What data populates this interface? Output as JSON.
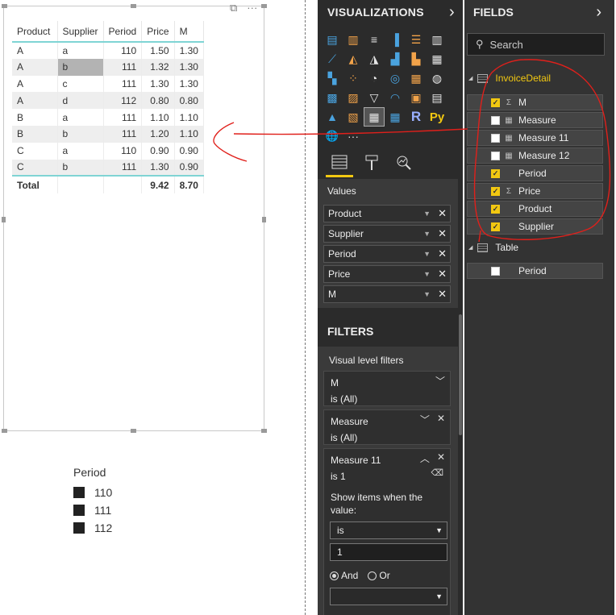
{
  "table": {
    "columns": [
      "Product",
      "Supplier",
      "Period",
      "Price",
      "M"
    ],
    "rows": [
      [
        "A",
        "a",
        "110",
        "1.50",
        "1.30"
      ],
      [
        "A",
        "b",
        "111",
        "1.32",
        "1.30"
      ],
      [
        "A",
        "c",
        "111",
        "1.30",
        "1.30"
      ],
      [
        "A",
        "d",
        "112",
        "0.80",
        "0.80"
      ],
      [
        "B",
        "a",
        "111",
        "1.10",
        "1.10"
      ],
      [
        "B",
        "b",
        "111",
        "1.20",
        "1.10"
      ],
      [
        "C",
        "a",
        "110",
        "0.90",
        "0.90"
      ],
      [
        "C",
        "b",
        "111",
        "1.30",
        "0.90"
      ]
    ],
    "total": {
      "label": "Total",
      "price": "9.42",
      "m": "8.70"
    },
    "header_icons": [
      "focus-mode-icon",
      "more-options-icon"
    ]
  },
  "slicer": {
    "title": "Period",
    "items": [
      "110",
      "111",
      "112"
    ]
  },
  "visualizations": {
    "title": "VISUALIZATIONS",
    "chevron": "›",
    "more": "···",
    "r_label": "R",
    "py_label": "Py",
    "icons": [
      "stacked-bar-icon",
      "stacked-column-icon",
      "clustered-bar-icon",
      "clustered-column-icon",
      "100-bar-icon",
      "100-column-icon",
      "line-chart-icon",
      "area-chart-icon",
      "stacked-area-icon",
      "line-column-icon",
      "line-clustered-icon",
      "ribbon-chart-icon",
      "waterfall-icon",
      "scatter-icon",
      "pie-chart-icon",
      "donut-icon",
      "treemap-icon",
      "map-icon",
      "filled-map-icon",
      "shape-map-icon",
      "funnel-icon",
      "gauge-icon",
      "card-icon",
      "multirow-card-icon",
      "kpi-icon",
      "slicer-icon",
      "table-icon",
      "matrix-icon",
      "r-visual-icon",
      "python-visual-icon"
    ],
    "build_tabs": [
      "fields-tab-icon",
      "format-paint-icon",
      "analytics-icon"
    ],
    "values_label": "Values",
    "values": [
      "Product",
      "Supplier",
      "Period",
      "Price",
      "M"
    ]
  },
  "filters": {
    "title": "FILTERS",
    "subtitle": "Visual level filters",
    "cards": [
      {
        "name": "M",
        "state": "is (All)"
      },
      {
        "name": "Measure",
        "state": "is (All)"
      },
      {
        "name": "Measure 11",
        "state": "is 1"
      }
    ],
    "show_items_label": "Show items when the value:",
    "operator": "is",
    "value": "1",
    "logic_and": "And",
    "logic_or": "Or",
    "second_operator": ""
  },
  "fields": {
    "title": "FIELDS",
    "chevron": "›",
    "search_placeholder": "Search",
    "tables": [
      {
        "name": "InvoiceDetail",
        "fields": [
          {
            "name": "M",
            "checked": true,
            "type": "Σ"
          },
          {
            "name": "Measure",
            "checked": false,
            "type": "▦"
          },
          {
            "name": "Measure 11",
            "checked": false,
            "type": "▦"
          },
          {
            "name": "Measure 12",
            "checked": false,
            "type": "▦"
          },
          {
            "name": "Period",
            "checked": true,
            "type": ""
          },
          {
            "name": "Price",
            "checked": true,
            "type": "Σ"
          },
          {
            "name": "Product",
            "checked": true,
            "type": ""
          },
          {
            "name": "Supplier",
            "checked": true,
            "type": ""
          }
        ]
      },
      {
        "name": "Table",
        "fields": [
          {
            "name": "Period",
            "checked": false,
            "type": ""
          }
        ]
      }
    ]
  },
  "colors": {
    "accent_yellow": "#F2C811",
    "pane_dark": "#2B2B2B",
    "annotation_red": "#E0201B",
    "table_rule": "#7FD4D4"
  }
}
